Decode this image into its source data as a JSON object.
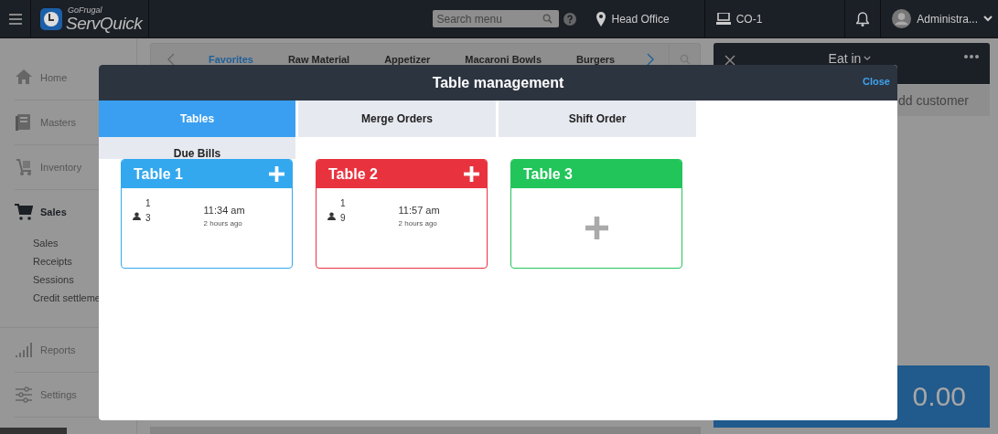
{
  "top_bar": {
    "brand_small": "GoFrugal",
    "brand": "ServQuick",
    "search": {
      "placeholder": "Search menu"
    },
    "location": "Head Office",
    "counter": "CO-1",
    "user": "Administra..."
  },
  "sidebar": {
    "items": [
      {
        "label": "Home",
        "selected": false
      },
      {
        "label": "Masters",
        "selected": false
      },
      {
        "label": "Inventory",
        "selected": false
      },
      {
        "label": "Sales",
        "selected": true,
        "children": [
          {
            "label": "Sales"
          },
          {
            "label": "Receipts"
          },
          {
            "label": "Sessions"
          },
          {
            "label": "Credit settleme"
          }
        ]
      },
      {
        "label": "Reports",
        "selected": false
      },
      {
        "label": "Settings",
        "selected": false
      }
    ]
  },
  "categories": [
    {
      "label": "Favorites",
      "selected": true
    },
    {
      "label": "Raw Material",
      "selected": false
    },
    {
      "label": "Appetizer",
      "selected": false
    },
    {
      "label": "Macaroni Bowls",
      "selected": false
    },
    {
      "label": "Burgers",
      "selected": false
    }
  ],
  "order_panel": {
    "mode": "Eat in",
    "customer": "dd customer",
    "total": "0.00"
  },
  "modal": {
    "title": "Table management",
    "close": "Close",
    "tabs": [
      {
        "label": "Tables",
        "selected": true
      },
      {
        "label": "Merge Orders",
        "selected": false
      },
      {
        "label": "Shift Order",
        "selected": false
      },
      {
        "label": "Due Bills",
        "selected": false
      }
    ],
    "tables": [
      {
        "name": "Table 1",
        "kind": "occupied",
        "color": "#33a8ee",
        "value_1": "1",
        "value_2": "3",
        "time": "11:34 am",
        "ago": "2 hours ago"
      },
      {
        "name": "Table 2",
        "kind": "occupied",
        "color": "#e8333f",
        "value_1": "1",
        "value_2": "9",
        "time": "11:57 am",
        "ago": "2 hours ago"
      },
      {
        "name": "Table 3",
        "kind": "empty",
        "color": "#22c55a"
      }
    ]
  }
}
